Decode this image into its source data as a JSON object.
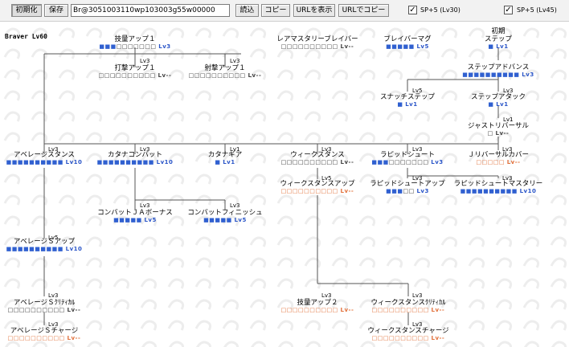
{
  "toolbar": {
    "reset": "初期化",
    "save": "保存",
    "code": "Br@3051003110wp103003g55w00000",
    "load": "読込",
    "copy": "コピー",
    "show_url": "URLを表示",
    "copy_url": "URLでコピー",
    "sp1_label": "SP+5 (Lv30)",
    "sp1_checked": "✓",
    "sp2_label": "SP+5 (Lv45)",
    "sp2_checked": "✓"
  },
  "tree": {
    "title": "Braver Lv60",
    "nodes": [
      {
        "name": "技量アップ１",
        "filled": 3,
        "total": 10,
        "lv": "Lv3",
        "state": "active"
      },
      {
        "name": "打撃アップ１",
        "filled": 0,
        "total": 10,
        "lv": "Lv--",
        "state": "gray"
      },
      {
        "name": "射撃アップ１",
        "filled": 0,
        "total": 10,
        "lv": "Lv--",
        "state": "gray"
      },
      {
        "name": "レアマスタリーブレイバー",
        "filled": 0,
        "total": 10,
        "lv": "Lv--",
        "state": "gray"
      },
      {
        "name": "ブレイバーマグ",
        "filled": 5,
        "total": 5,
        "lv": "Lv5",
        "state": "active"
      },
      {
        "name": "初期\nステップ",
        "filled": 1,
        "total": 1,
        "lv": "Lv1",
        "state": "active"
      },
      {
        "name": "ステップアドバンス",
        "filled": 10,
        "total": 10,
        "lv": "Lv3",
        "state": "active"
      },
      {
        "name": "スナッチステップ",
        "filled": 1,
        "total": 1,
        "lv": "Lv1",
        "state": "active"
      },
      {
        "name": "ステップアタック",
        "filled": 1,
        "total": 1,
        "lv": "Lv1",
        "state": "active"
      },
      {
        "name": "ジャストリバーサル",
        "filled": 0,
        "total": 1,
        "lv": "Lv--",
        "state": "gray"
      },
      {
        "name": "アベレージスタンス",
        "filled": 10,
        "total": 10,
        "lv": "Lv10",
        "state": "active"
      },
      {
        "name": "カタナコンバット",
        "filled": 10,
        "total": 10,
        "lv": "Lv10",
        "state": "active"
      },
      {
        "name": "カタナギア",
        "filled": 1,
        "total": 1,
        "lv": "Lv1",
        "state": "active"
      },
      {
        "name": "ウィークスタンス",
        "filled": 0,
        "total": 10,
        "lv": "Lv--",
        "state": "gray"
      },
      {
        "name": "ラピッドシュート",
        "filled": 3,
        "total": 10,
        "lv": "Lv3",
        "state": "active"
      },
      {
        "name": "Ｊリバーサルカバー",
        "filled": 0,
        "total": 5,
        "lv": "Lv--",
        "state": "orange"
      },
      {
        "name": "ウィークスタンスアップ",
        "filled": 0,
        "total": 10,
        "lv": "Lv--",
        "state": "orange"
      },
      {
        "name": "ラピッドシュートアップ",
        "filled": 3,
        "total": 5,
        "lv": "Lv3",
        "state": "active"
      },
      {
        "name": "ラピッドシュートマスタリー",
        "filled": 10,
        "total": 10,
        "lv": "Lv10",
        "state": "active"
      },
      {
        "name": "コンバットＪＡボーナス",
        "filled": 5,
        "total": 5,
        "lv": "Lv5",
        "state": "active"
      },
      {
        "name": "コンバットフィニッシュ",
        "filled": 5,
        "total": 5,
        "lv": "Lv5",
        "state": "active"
      },
      {
        "name": "アベレージＳアップ",
        "filled": 10,
        "total": 10,
        "lv": "Lv10",
        "state": "active"
      },
      {
        "name": "アベレージＳｸﾘﾃｨｶﾙ",
        "filled": 0,
        "total": 10,
        "lv": "Lv--",
        "state": "gray"
      },
      {
        "name": "アベレージＳチャージ",
        "filled": 0,
        "total": 10,
        "lv": "Lv--",
        "state": "orange"
      },
      {
        "name": "技量アップ２",
        "filled": 0,
        "total": 10,
        "lv": "Lv--",
        "state": "orange"
      },
      {
        "name": "ウィークスタンスｸﾘﾃｨｶﾙ",
        "filled": 0,
        "total": 10,
        "lv": "Lv--",
        "state": "orange"
      },
      {
        "name": "ウィークスタンスチャージ",
        "filled": 0,
        "total": 10,
        "lv": "Lv--",
        "state": "orange"
      }
    ],
    "reqs": [
      "Lv3",
      "Lv3",
      "Lv3",
      "Lv3",
      "Lv3",
      "Lv1",
      "Lv3",
      "Lv3",
      "Lv3",
      "Lv1",
      "Lv3",
      "Lv5",
      "Lv3",
      "Lv3",
      "Lv3",
      "Lv3",
      "Lv3",
      "Lv5",
      "Lv3",
      "Lv3",
      "Lv3",
      "Lv3"
    ]
  }
}
